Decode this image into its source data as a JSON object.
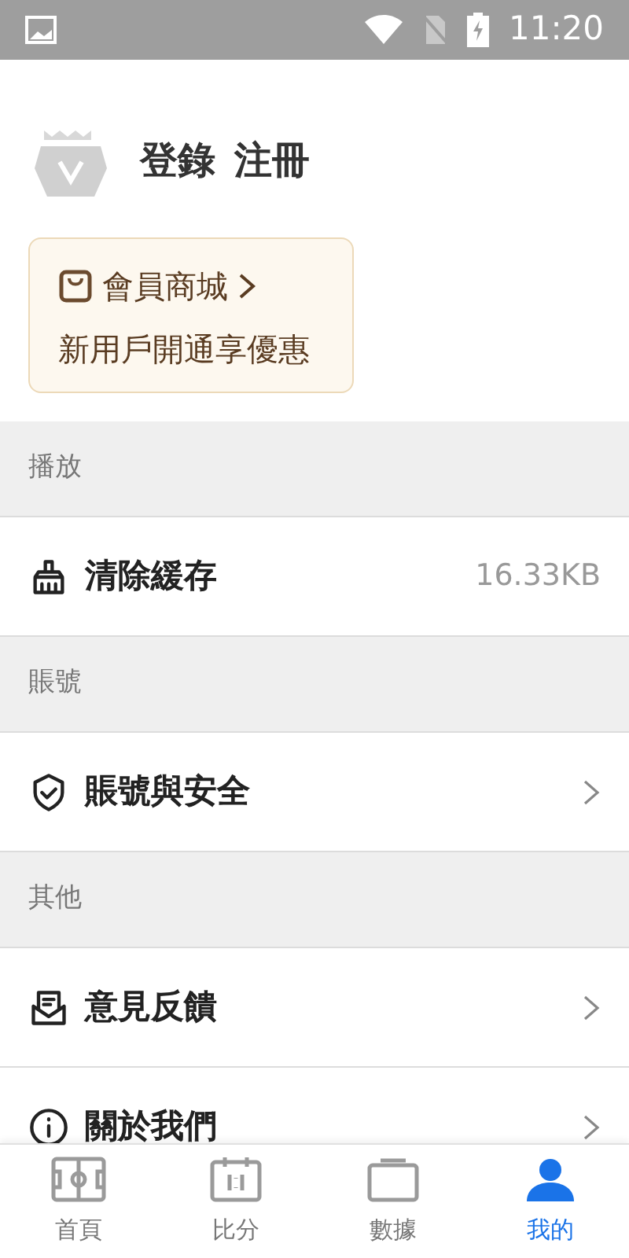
{
  "status_bar": {
    "time": "11:20"
  },
  "profile": {
    "login": "登錄",
    "register": "注冊"
  },
  "member_card": {
    "title": "會員商城",
    "subtitle": "新用戶開通享優惠"
  },
  "sections": [
    {
      "header": "播放",
      "rows": [
        {
          "kind": "value",
          "label": "清除緩存",
          "value": "16.33KB"
        }
      ]
    },
    {
      "header": "賬號",
      "rows": [
        {
          "kind": "link",
          "label": "賬號與安全"
        }
      ]
    },
    {
      "header": "其他",
      "rows": [
        {
          "kind": "link",
          "label": "意見反饋"
        },
        {
          "kind": "link",
          "label": "關於我們"
        }
      ]
    }
  ],
  "bottom_nav": [
    {
      "label": "首頁",
      "selected": false
    },
    {
      "label": "比分",
      "selected": false
    },
    {
      "label": "數據",
      "selected": false
    },
    {
      "label": "我的",
      "selected": true
    }
  ]
}
